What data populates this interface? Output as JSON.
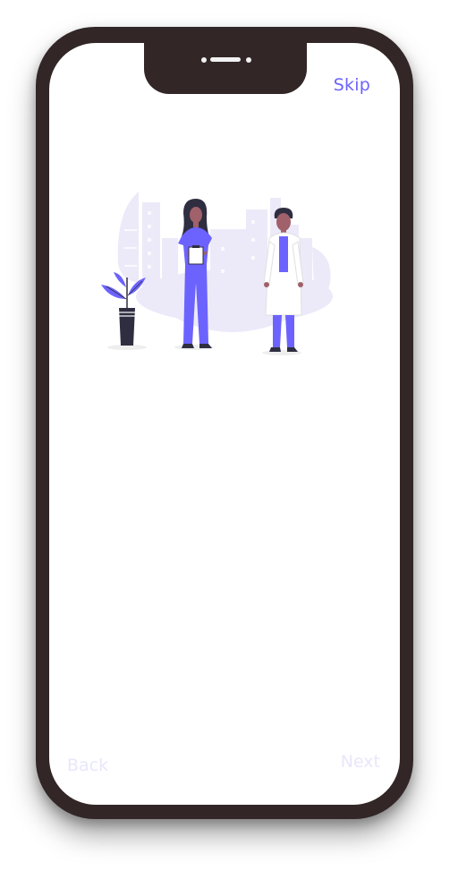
{
  "onboarding": {
    "skip_label": "Skip",
    "back_label": "Back",
    "next_label": "Next",
    "illustration_icon": "medical-staff-illustration"
  },
  "colors": {
    "frame": "#322627",
    "accent": "#6c63ff",
    "disabled": "#e8e7fb",
    "illustration_bg": "#eceaf9"
  }
}
